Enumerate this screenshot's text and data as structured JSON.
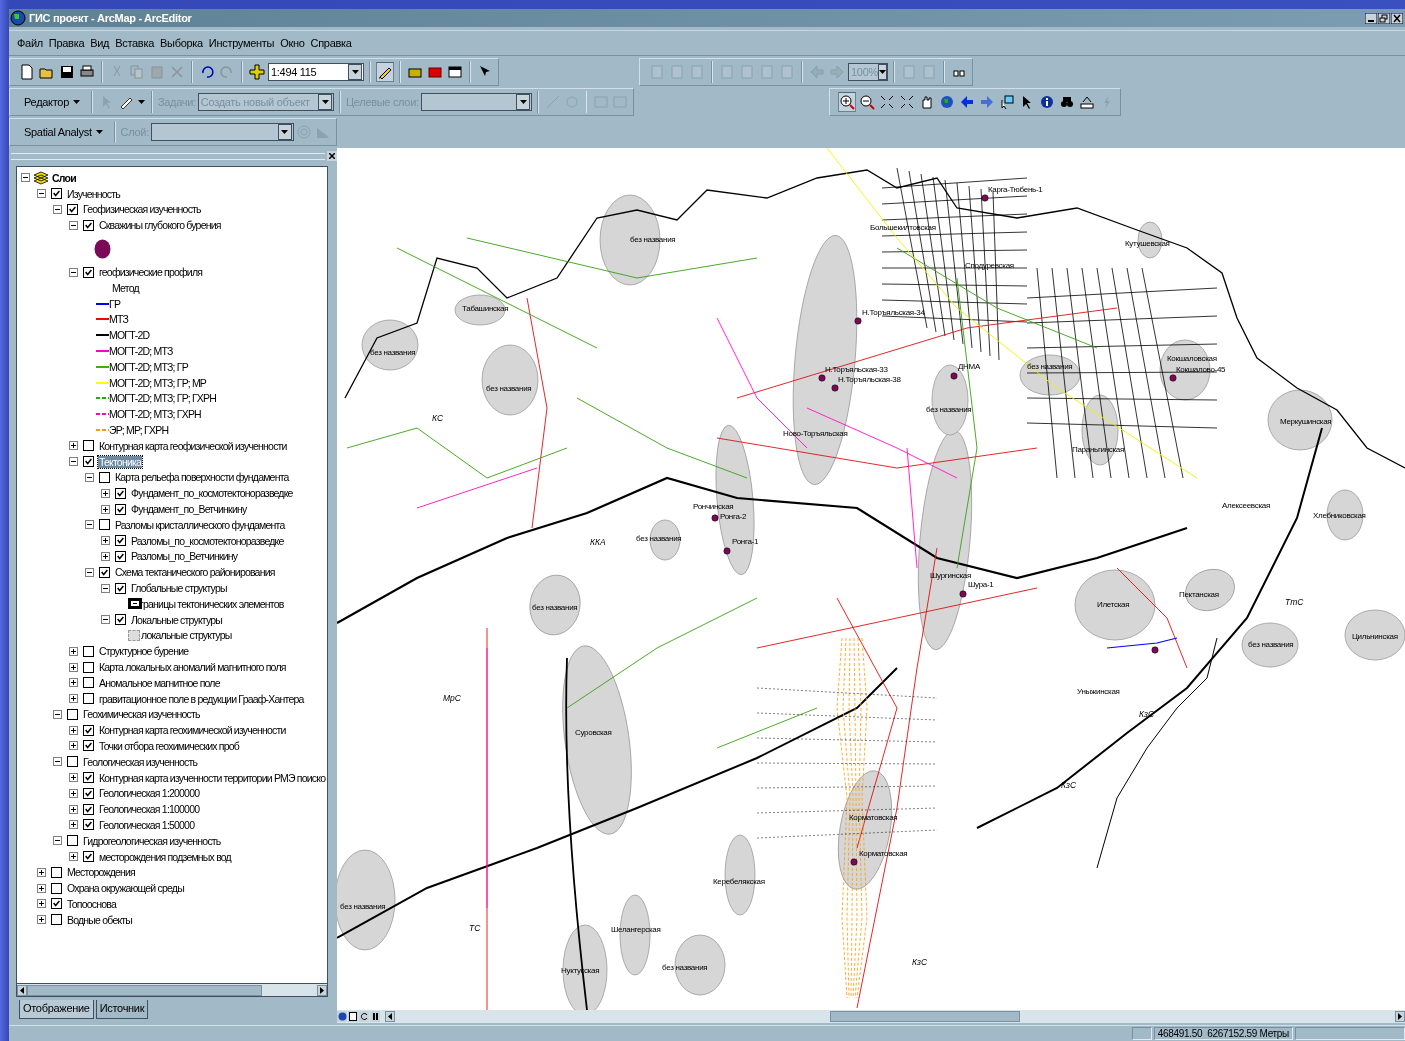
{
  "window": {
    "title": "ГИС проект - ArcMap - ArcEditor"
  },
  "menu": [
    "Файл",
    "Правка",
    "Вид",
    "Вставка",
    "Выборка",
    "Инструменты",
    "Окно",
    "Справка"
  ],
  "standard_toolbar": {
    "buttons": [
      {
        "disabled": false
      },
      {
        "disabled": false
      },
      {
        "disabled": false
      },
      {
        "disabled": false
      },
      {
        "disabled": true
      },
      {
        "disabled": true
      },
      {
        "disabled": true
      },
      {
        "disabled": true
      },
      {
        "disabled": false
      },
      {
        "disabled": true
      },
      {
        "disabled": false
      }
    ],
    "scale": "1:494 115",
    "tools": [
      {
        "disabled": false,
        "selected": true
      },
      {
        "disabled": false,
        "selected": false
      },
      {
        "disabled": false,
        "selected": false
      },
      {
        "disabled": false,
        "selected": false
      },
      {
        "disabled": false,
        "selected": false
      }
    ]
  },
  "layout_toolbar": {
    "buttons": [
      {
        "disabled": true
      },
      {
        "disabled": true
      },
      {
        "disabled": true
      },
      {
        "disabled": true
      },
      {
        "disabled": true
      },
      {
        "disabled": true
      },
      {
        "disabled": true
      },
      {
        "disabled": true
      },
      {
        "disabled": true
      }
    ],
    "zoom": "100%",
    "zoom_disabled": true,
    "extra": [
      {
        "disabled": true
      },
      {
        "disabled": true
      },
      {
        "disabled": false
      }
    ]
  },
  "editor_toolbar": {
    "menu": "Редактор",
    "task_label": "Задачи:",
    "task": "Создать новый объект",
    "target_label": "Целевые слои:",
    "disabled": true,
    "buttons": [
      {
        "disabled": true
      },
      {
        "disabled": false
      },
      {
        "disabled": true
      },
      {
        "disabled": true
      },
      {
        "disabled": true
      },
      {
        "disabled": true
      }
    ]
  },
  "tools_toolbar": {
    "buttons": [
      {
        "disabled": false,
        "selected": true
      },
      {
        "disabled": false,
        "selected": false
      },
      {
        "disabled": false,
        "selected": false
      },
      {
        "disabled": false,
        "selected": false
      },
      {
        "disabled": false,
        "selected": false
      },
      {
        "disabled": false,
        "selected": false
      },
      {
        "disabled": false,
        "selected": false
      },
      {
        "disabled": true,
        "selected": false
      },
      {
        "disabled": false,
        "selected": false
      },
      {
        "disabled": false,
        "selected": false
      },
      {
        "disabled": false,
        "selected": false
      },
      {
        "disabled": false,
        "selected": false
      },
      {
        "disabled": false,
        "selected": false
      },
      {
        "disabled": true,
        "selected": false
      }
    ]
  },
  "spatial_analyst_toolbar": {
    "menu": "Spatial Analyst",
    "layer_label": "Слой:",
    "disabled": true
  },
  "toc": {
    "root": {
      "label": "Слои",
      "expanded": true
    },
    "tabs": [
      {
        "label": "Отображение",
        "selected": true
      },
      {
        "label": "Источник",
        "selected": false
      }
    ],
    "layers": [
      {
        "kind": "layer",
        "label": "Изученность",
        "checked": true,
        "expanded": true,
        "selected": false,
        "children": [
          {
            "kind": "layer",
            "label": "Геофизическая изученность",
            "checked": true,
            "expanded": true,
            "selected": false,
            "children": [
              {
                "kind": "layer",
                "label": "Скважины глубокого бурения",
                "checked": true,
                "expanded": true,
                "selected": false,
                "children": [
                  {
                    "kind": "legend-dot",
                    "color": "#7a0a55"
                  }
                ]
              },
              {
                "kind": "layer",
                "label": "геофизические профиля",
                "checked": true,
                "expanded": true,
                "selected": false,
                "children": [
                  {
                    "kind": "legend-heading",
                    "label": "Метод"
                  },
                  {
                    "kind": "legend-line",
                    "label": "ГР",
                    "color": "#0000ff",
                    "dashed": false
                  },
                  {
                    "kind": "legend-line",
                    "label": "МТЗ",
                    "color": "#ff0000",
                    "dashed": false
                  },
                  {
                    "kind": "legend-line",
                    "label": "МОГТ-2D",
                    "color": "#000000",
                    "dashed": false
                  },
                  {
                    "kind": "legend-line",
                    "label": "МОГТ-2D; МТЗ",
                    "color": "#ff00c8",
                    "dashed": false
                  },
                  {
                    "kind": "legend-line",
                    "label": "МОГТ-2D; МТЗ; ГР",
                    "color": "#40b000",
                    "dashed": false
                  },
                  {
                    "kind": "legend-line",
                    "label": "МОГТ-2D; МТЗ; ГР; МР",
                    "color": "#ffff00",
                    "dashed": false
                  },
                  {
                    "kind": "legend-line",
                    "label": "МОГТ-2D; МТЗ; ГР; ГХРН",
                    "color": "#20b000",
                    "dashed": true
                  },
                  {
                    "kind": "legend-line",
                    "label": "МОГТ-2D; МТЗ; ГХРН",
                    "color": "#ff00c8",
                    "dashed": true
                  },
                  {
                    "kind": "legend-line",
                    "label": "ЭР; МР; ГХРН",
                    "color": "#ff9900",
                    "dashed": true
                  }
                ]
              },
              {
                "kind": "layer",
                "label": "Контурная карта геофизической изученности",
                "checked": false,
                "expanded": false,
                "selected": false
              },
              {
                "kind": "layer",
                "label": "Тектоника",
                "checked": true,
                "expanded": true,
                "selected": true,
                "children": [
                  {
                    "kind": "layer",
                    "label": "Карта рельефа поверхности фундамента",
                    "checked": false,
                    "expanded": true,
                    "selected": false,
                    "children": [
                      {
                        "kind": "layer",
                        "label": "Фундамент_по_космотектоноразведке",
                        "checked": true,
                        "expanded": false,
                        "selected": false
                      },
                      {
                        "kind": "layer",
                        "label": "Фундамент_по_Ветчинкину",
                        "checked": true,
                        "expanded": false,
                        "selected": false
                      }
                    ]
                  },
                  {
                    "kind": "layer",
                    "label": "Разломы кристаллического фундамента",
                    "checked": false,
                    "expanded": true,
                    "selected": false,
                    "children": [
                      {
                        "kind": "layer",
                        "label": "Разломы_по_космотектоноразведке",
                        "checked": true,
                        "expanded": false,
                        "selected": false
                      },
                      {
                        "kind": "layer",
                        "label": "Разломы_по_Ветчинкину",
                        "checked": true,
                        "expanded": false,
                        "selected": false
                      }
                    ]
                  },
                  {
                    "kind": "layer",
                    "label": "Схема тектанического районирования",
                    "checked": true,
                    "expanded": true,
                    "selected": false,
                    "children": [
                      {
                        "kind": "layer",
                        "label": "Глобальные структуры",
                        "checked": true,
                        "expanded": true,
                        "selected": false,
                        "children": [
                          {
                            "kind": "legend-box",
                            "label": "границы тектонических элементов"
                          }
                        ]
                      },
                      {
                        "kind": "layer",
                        "label": "Локальные структуры",
                        "checked": true,
                        "expanded": true,
                        "selected": false,
                        "children": [
                          {
                            "kind": "legend-area",
                            "label": "локальные структуры"
                          }
                        ]
                      }
                    ]
                  }
                ]
              },
              {
                "kind": "layer",
                "label": "Структурное бурение",
                "checked": false,
                "expanded": false,
                "selected": false
              },
              {
                "kind": "layer",
                "label": "Карта локальных аномалий магнитного поля",
                "checked": false,
                "expanded": false,
                "selected": false
              },
              {
                "kind": "layer",
                "label": "Аномальное магнитное поле",
                "checked": false,
                "expanded": false,
                "selected": false
              },
              {
                "kind": "layer",
                "label": "гравитационное поле в редукции Грааф-Хантера",
                "checked": false,
                "expanded": false,
                "selected": false
              }
            ]
          },
          {
            "kind": "layer",
            "label": "Геохимическая изученность",
            "checked": false,
            "expanded": true,
            "selected": false,
            "children": [
              {
                "kind": "layer",
                "label": "Контурная карта геохимической изученности",
                "checked": true,
                "expanded": false,
                "selected": false
              },
              {
                "kind": "layer",
                "label": "Точки отбора геохимических проб",
                "checked": true,
                "expanded": false,
                "selected": false
              }
            ]
          },
          {
            "kind": "layer",
            "label": "Геологическая изученность",
            "checked": false,
            "expanded": true,
            "selected": false,
            "children": [
              {
                "kind": "layer",
                "label": "Контурная карта изученности территории РМЭ поиско",
                "checked": true,
                "expanded": false,
                "selected": false
              },
              {
                "kind": "layer",
                "label": "Геологическая 1:200000",
                "checked": true,
                "expanded": false,
                "selected": false
              },
              {
                "kind": "layer",
                "label": "Геологическая 1:100000",
                "checked": true,
                "expanded": false,
                "selected": false
              },
              {
                "kind": "layer",
                "label": "Геологическая 1:50000",
                "checked": true,
                "expanded": false,
                "selected": false
              }
            ]
          },
          {
            "kind": "layer",
            "label": "Гидрогеологическая изученность",
            "checked": false,
            "expanded": true,
            "selected": false,
            "children": [
              {
                "kind": "layer",
                "label": "месторождения подземных вод",
                "checked": true,
                "expanded": false,
                "selected": false
              }
            ]
          }
        ]
      },
      {
        "kind": "layer",
        "label": "Месторождения",
        "checked": false,
        "expanded": false,
        "selected": false
      },
      {
        "kind": "layer",
        "label": "Охрана окружающей среды",
        "checked": false,
        "expanded": false,
        "selected": false
      },
      {
        "kind": "layer",
        "label": "Топооснова",
        "checked": true,
        "expanded": false,
        "selected": false
      },
      {
        "kind": "layer",
        "label": "Водные обекты",
        "checked": false,
        "expanded": false,
        "selected": false
      }
    ]
  },
  "map": {
    "labels": [
      {
        "text": "Карга-Тюбень-1",
        "kind": "structure"
      },
      {
        "text": "Большекилтовская",
        "kind": "structure"
      },
      {
        "text": "без названия",
        "kind": "structure"
      },
      {
        "text": "Кутушевская",
        "kind": "structure"
      },
      {
        "text": "Сподуревская",
        "kind": "structure"
      },
      {
        "text": "Табашинская",
        "kind": "structure"
      },
      {
        "text": "Н.Торъяльская-34",
        "kind": "structure"
      },
      {
        "text": "без названия",
        "kind": "structure"
      },
      {
        "text": "без названия",
        "kind": "structure"
      },
      {
        "text": "Н.Торъяльская-33",
        "kind": "structure"
      },
      {
        "text": "Н.Торъяльская-38",
        "kind": "structure"
      },
      {
        "text": "ДНМА",
        "kind": "structure"
      },
      {
        "text": "без названия",
        "kind": "structure"
      },
      {
        "text": "Кокшаловская",
        "kind": "structure"
      },
      {
        "text": "Кокшалово-45",
        "kind": "structure"
      },
      {
        "text": "без названия",
        "kind": "structure"
      },
      {
        "text": "КС",
        "kind": "zone"
      },
      {
        "text": "Меркушинская",
        "kind": "structure"
      },
      {
        "text": "Ново-Торъяльская",
        "kind": "structure"
      },
      {
        "text": "Параньгинская",
        "kind": "structure"
      },
      {
        "text": "Рончинская",
        "kind": "structure"
      },
      {
        "text": "Ронга-2",
        "kind": "structure"
      },
      {
        "text": "Алексеевская",
        "kind": "structure"
      },
      {
        "text": "Хлебниковская",
        "kind": "structure"
      },
      {
        "text": "без названия",
        "kind": "structure"
      },
      {
        "text": "ККА",
        "kind": "zone"
      },
      {
        "text": "Ронга-1",
        "kind": "structure"
      },
      {
        "text": "Шургинская",
        "kind": "structure"
      },
      {
        "text": "Шура-1",
        "kind": "structure"
      },
      {
        "text": "Пектанская",
        "kind": "structure"
      },
      {
        "text": "Илетская",
        "kind": "structure"
      },
      {
        "text": "ТтС",
        "kind": "zone"
      },
      {
        "text": "без названия",
        "kind": "structure"
      },
      {
        "text": "Цильнинская",
        "kind": "structure"
      },
      {
        "text": "без названия",
        "kind": "structure"
      },
      {
        "text": "Уныжинская",
        "kind": "structure"
      },
      {
        "text": "МрС",
        "kind": "zone"
      },
      {
        "text": "КзС",
        "kind": "zone"
      },
      {
        "text": "Суровская",
        "kind": "structure"
      },
      {
        "text": "КзС",
        "kind": "zone"
      },
      {
        "text": "Корматовская",
        "kind": "structure"
      },
      {
        "text": "Корматовская",
        "kind": "structure"
      },
      {
        "text": "Керебелякская",
        "kind": "structure"
      },
      {
        "text": "без названия",
        "kind": "structure"
      },
      {
        "text": "Шелангерская",
        "kind": "structure"
      },
      {
        "text": "ТС",
        "kind": "zone"
      },
      {
        "text": "КзС",
        "kind": "zone"
      },
      {
        "text": "Нуктукская",
        "kind": "structure"
      },
      {
        "text": "без названия",
        "kind": "structure"
      }
    ]
  },
  "status_bar": {
    "coordinates": "468491.50  6267152.59 Метры"
  }
}
